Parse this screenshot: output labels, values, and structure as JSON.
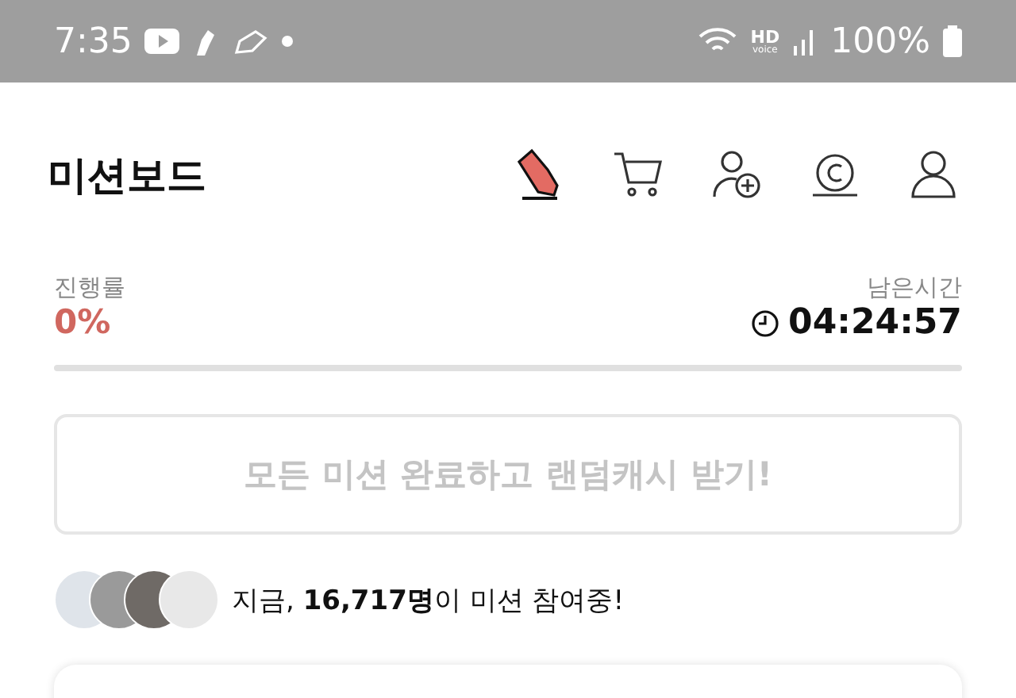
{
  "status_bar": {
    "time": "7:35",
    "hd_label": "HD",
    "voice_label": "voice",
    "battery": "100%"
  },
  "header": {
    "title": "미션보드"
  },
  "progress": {
    "label": "진행률",
    "value": "0%",
    "level": 0
  },
  "remaining": {
    "label": "남은시간",
    "value": "04:24:57"
  },
  "reward_button": {
    "label": "모든 미션 완료하고 랜덤캐시 받기!",
    "disabled": true
  },
  "participants": {
    "text": "지금, **16,717명**이 미션 참여중!"
  }
}
